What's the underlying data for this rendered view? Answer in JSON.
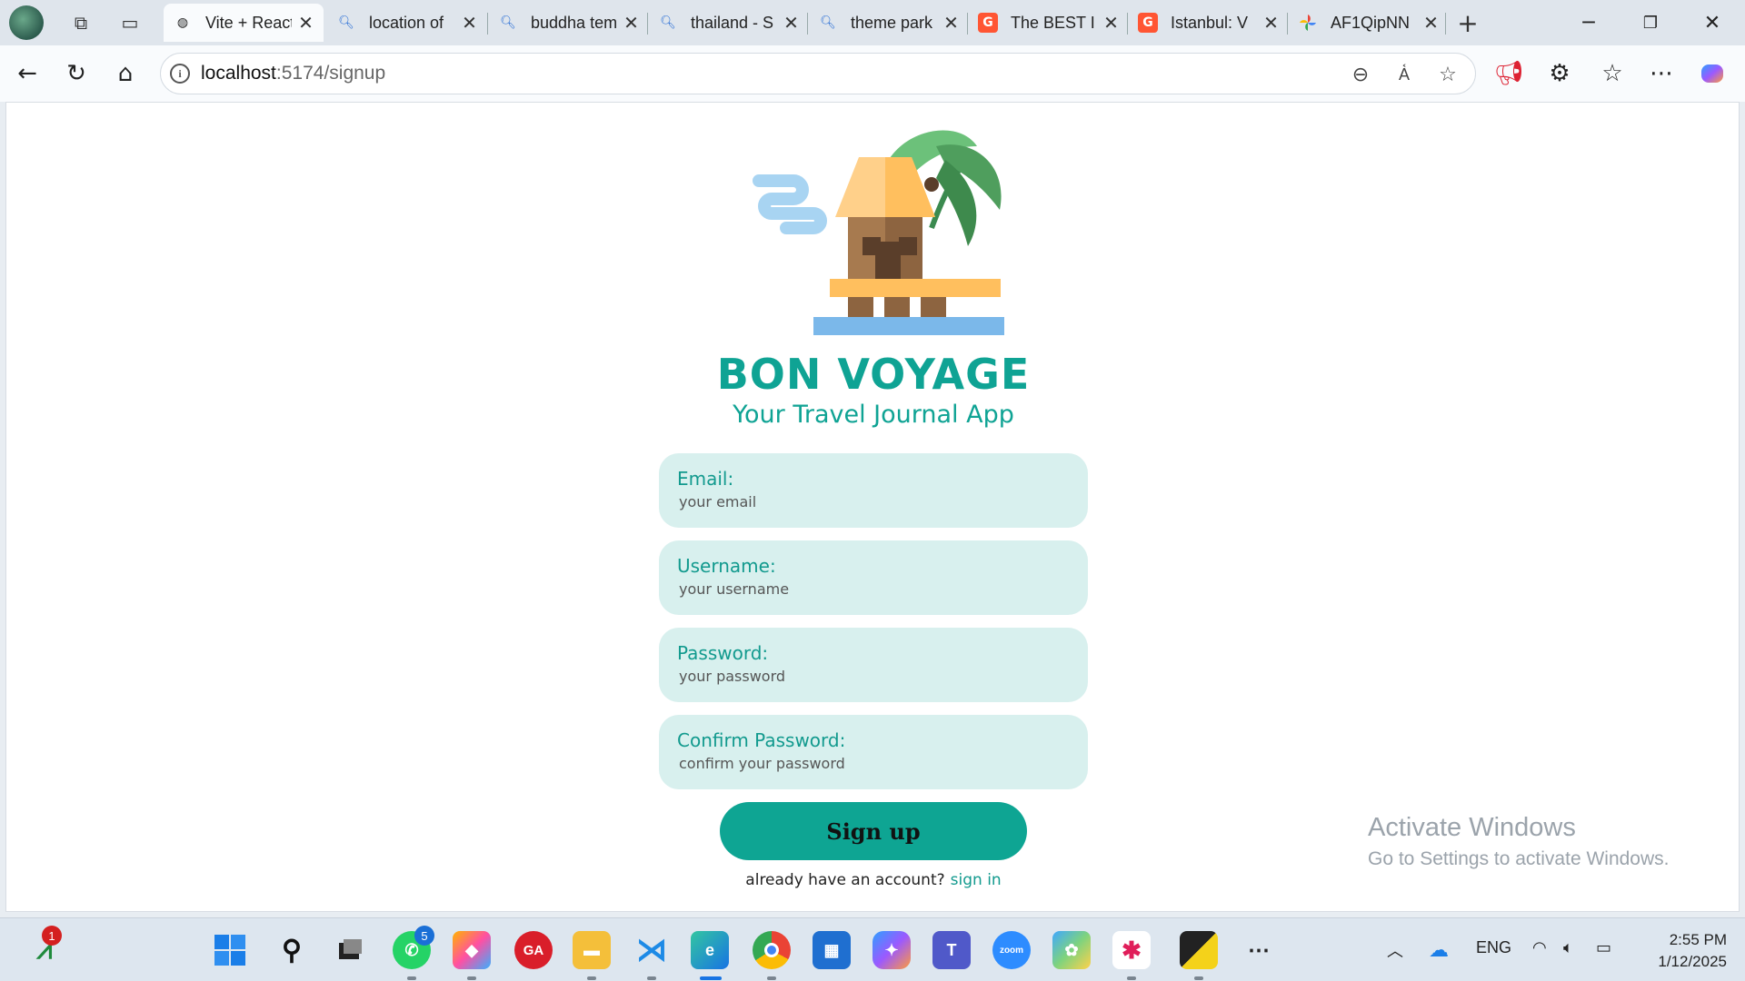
{
  "browser": {
    "tabs": [
      {
        "title": "Vite + React",
        "icon": "globe-icon"
      },
      {
        "title": "location of",
        "icon": "search-icon"
      },
      {
        "title": "buddha temple",
        "icon": "search-icon"
      },
      {
        "title": "thailand - S",
        "icon": "search-icon"
      },
      {
        "title": "theme park",
        "icon": "search-icon"
      },
      {
        "title": "The BEST I",
        "icon": "getyourguide-icon"
      },
      {
        "title": "Istanbul: V",
        "icon": "getyourguide-icon"
      },
      {
        "title": "AF1QipNN",
        "icon": "pinwheel-icon"
      }
    ],
    "url_host": "localhost",
    "url_path": ":5174/signup"
  },
  "app": {
    "brand": "BON VOYAGE",
    "tagline": "Your Travel Journal App",
    "fields": [
      {
        "label": "Email:",
        "placeholder": "your email"
      },
      {
        "label": "Username:",
        "placeholder": "your username"
      },
      {
        "label": "Password:",
        "placeholder": "your password"
      },
      {
        "label": "Confirm Password:",
        "placeholder": "confirm your password"
      }
    ],
    "submit_label": "Sign up",
    "signin_prompt": "already have an account?",
    "signin_link": "sign in",
    "accent_color": "#0fa394"
  },
  "watermark": {
    "title": "Activate Windows",
    "subtitle": "Go to Settings to activate Windows."
  },
  "taskbar": {
    "stocks_badge": "1",
    "whatsapp_badge": "5",
    "language": "ENG",
    "time": "2:55 PM",
    "date": "1/12/2025"
  }
}
